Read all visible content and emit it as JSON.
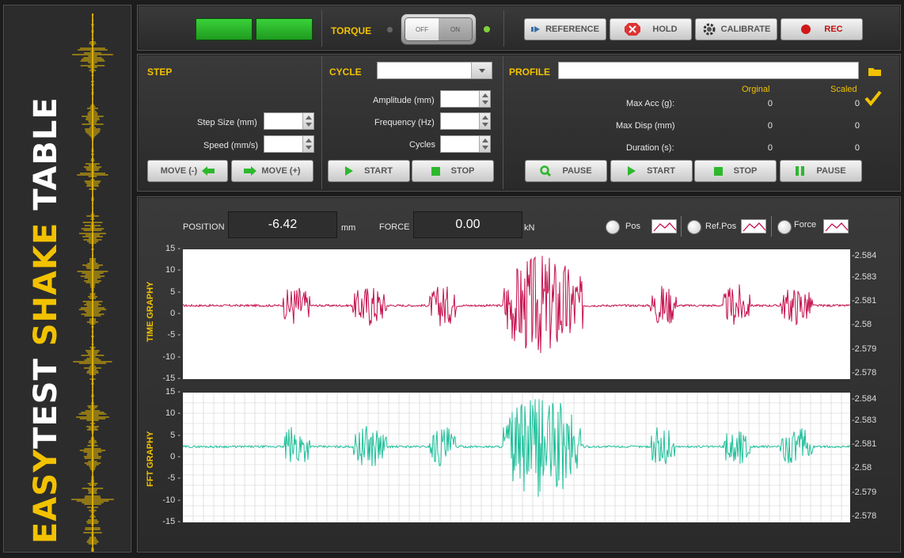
{
  "app": {
    "brand_easy": "EASY",
    "brand_test": "TEST",
    "brand_shake": "SHAKE",
    "brand_table": "TABLE"
  },
  "colors": {
    "accent": "#f2c200",
    "time_trace": "#c4104e",
    "fft_trace": "#1fbf9a",
    "led_green": "#2fbf2f"
  },
  "top": {
    "torque_label": "TORQUE",
    "switch_off": "OFF",
    "switch_on": "ON",
    "buttons": [
      {
        "label": "REFERENCE",
        "icon": "reference-icon"
      },
      {
        "label": "HOLD",
        "icon": "hold-icon"
      },
      {
        "label": "CALIBRATE",
        "icon": "gear-icon"
      },
      {
        "label": "REC",
        "icon": "record-icon"
      }
    ]
  },
  "step": {
    "title": "STEP",
    "step_size_label": "Step Size (mm)",
    "speed_label": "Speed (mm/s)",
    "move_minus": "MOVE (-)",
    "move_plus": "MOVE (+)"
  },
  "cycle": {
    "title": "CYCLE",
    "amplitude_label": "Amplitude (mm)",
    "frequency_label": "Frequency (Hz)",
    "cycles_label": "Cycles",
    "start": "START",
    "stop": "STOP"
  },
  "profile": {
    "title": "PROFILE",
    "col_original": "Orginal",
    "col_scaled": "Scaled",
    "rows": [
      {
        "label": "Max Acc (g):",
        "original": "0",
        "scaled": "0"
      },
      {
        "label": "Max Disp (mm)",
        "original": "0",
        "scaled": "0"
      },
      {
        "label": "Duration (s):",
        "original": "0",
        "scaled": "0"
      }
    ],
    "pause1": "PAUSE",
    "start": "START",
    "stop": "STOP",
    "pause2": "PAUSE"
  },
  "readouts": {
    "position_label": "POSITION",
    "position_value": "-6.42",
    "position_unit": "mm",
    "force_label": "FORCE",
    "force_value": "0.00",
    "force_unit": "kN",
    "toggle_pos": "Pos",
    "toggle_refpos": "Ref.Pos",
    "toggle_force": "Force"
  },
  "chart_data": [
    {
      "type": "line",
      "title": "TIME GRAPHY",
      "ylim": [
        -15,
        15
      ],
      "y_ticks": [
        "15 -",
        "10 -",
        "5 -",
        "0 -",
        "-5 -",
        "-10 -",
        "-15 -"
      ],
      "y2_ticks": [
        "-2.584",
        "-2.583",
        "-2.581",
        "-2.58",
        "-2.579",
        "-2.578"
      ],
      "baseline": 2,
      "grid": false,
      "bursts": [
        {
          "center": 0.17,
          "width": 0.04,
          "amp": 5
        },
        {
          "center": 0.28,
          "width": 0.05,
          "amp": 5
        },
        {
          "center": 0.39,
          "width": 0.04,
          "amp": 5
        },
        {
          "center": 0.54,
          "width": 0.12,
          "amp": 12
        },
        {
          "center": 0.72,
          "width": 0.04,
          "amp": 5
        },
        {
          "center": 0.83,
          "width": 0.04,
          "amp": 5
        },
        {
          "center": 0.92,
          "width": 0.05,
          "amp": 4.5
        }
      ]
    },
    {
      "type": "line",
      "title": "FFT GRAPHY",
      "ylim": [
        -15,
        15
      ],
      "y_ticks": [
        "15 -",
        "10 -",
        "5 -",
        "0 -",
        "-5 -",
        "-10 -",
        "-15 -"
      ],
      "y2_ticks": [
        "-2.584",
        "-2.583",
        "-2.581",
        "-2.58",
        "-2.579",
        "-2.578"
      ],
      "baseline": 2.5,
      "grid": true,
      "bursts": [
        {
          "center": 0.17,
          "width": 0.04,
          "amp": 5
        },
        {
          "center": 0.28,
          "width": 0.05,
          "amp": 5
        },
        {
          "center": 0.39,
          "width": 0.04,
          "amp": 5
        },
        {
          "center": 0.54,
          "width": 0.12,
          "amp": 12
        },
        {
          "center": 0.72,
          "width": 0.04,
          "amp": 5
        },
        {
          "center": 0.83,
          "width": 0.04,
          "amp": 5
        },
        {
          "center": 0.92,
          "width": 0.05,
          "amp": 4.5
        }
      ]
    }
  ]
}
